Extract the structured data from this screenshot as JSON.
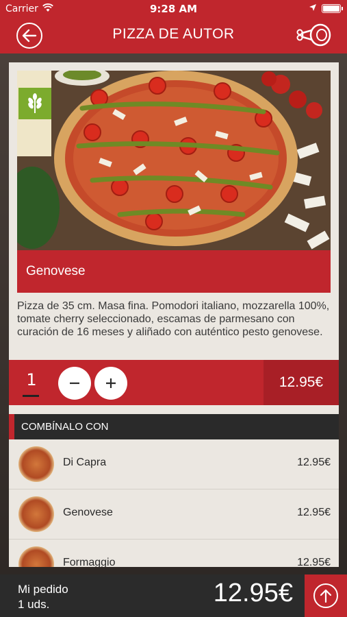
{
  "status_bar": {
    "carrier": "Carrier",
    "time": "9:28 AM"
  },
  "nav": {
    "title": "PIZZA DE AUTOR"
  },
  "product": {
    "name": "Genovese",
    "description": "Pizza de 35 cm. Masa fina. Pomodori italiano, mozzarella 100%, tomate cherry seleccionado, escamas de parmesano con curación de 16 meses y aliñado con auténtico pesto genovese.",
    "quantity": "1",
    "price": "12.95€"
  },
  "combine": {
    "header": "COMBÍNALO CON",
    "items": [
      {
        "name": "Di Capra",
        "price": "12.95€"
      },
      {
        "name": "Genovese",
        "price": "12.95€"
      },
      {
        "name": "Formaggio",
        "price": "12.95€"
      }
    ]
  },
  "footer": {
    "label": "Mi pedido",
    "units": "1 uds.",
    "total": "12.95€"
  },
  "colors": {
    "brand_red": "#c0262d",
    "dark": "#2b2b2b",
    "veg_green": "#7cab2d",
    "card_bg": "#ebe7e1"
  },
  "icons": {
    "back": "back-arrow-icon",
    "ham": "ham-leg-icon",
    "veg": "wheat-icon",
    "minus": "minus-icon",
    "plus": "plus-icon",
    "up": "up-arrow-icon"
  }
}
